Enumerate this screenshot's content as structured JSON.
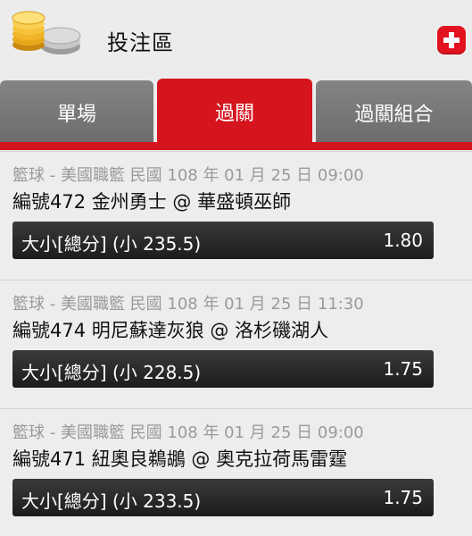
{
  "header": {
    "title": "投注區",
    "logo_icon": "coins-icon",
    "add_icon": "plus-icon",
    "accent_color": "#d5141d"
  },
  "tabs": [
    {
      "label": "單場",
      "active": false
    },
    {
      "label": "過關",
      "active": true
    },
    {
      "label": "過關組合",
      "active": false
    }
  ],
  "bets": [
    {
      "meta": "籃球 - 美國職籃 民國 108 年 01 月 25 日 09:00",
      "match": "編號472 金州勇士 @ 華盛頓巫師",
      "bet_label": "大小[總分] (小 235.5)",
      "odds": "1.80"
    },
    {
      "meta": "籃球 - 美國職籃 民國 108 年 01 月 25 日 11:30",
      "match": "編號474 明尼蘇達灰狼 @ 洛杉磯湖人",
      "bet_label": "大小[總分] (小 228.5)",
      "odds": "1.75"
    },
    {
      "meta": "籃球 - 美國職籃 民國 108 年 01 月 25 日 09:00",
      "match": "編號471 紐奧良鵜鶘 @ 奧克拉荷馬雷霆",
      "bet_label": "大小[總分] (小 233.5)",
      "odds": "1.75"
    }
  ]
}
